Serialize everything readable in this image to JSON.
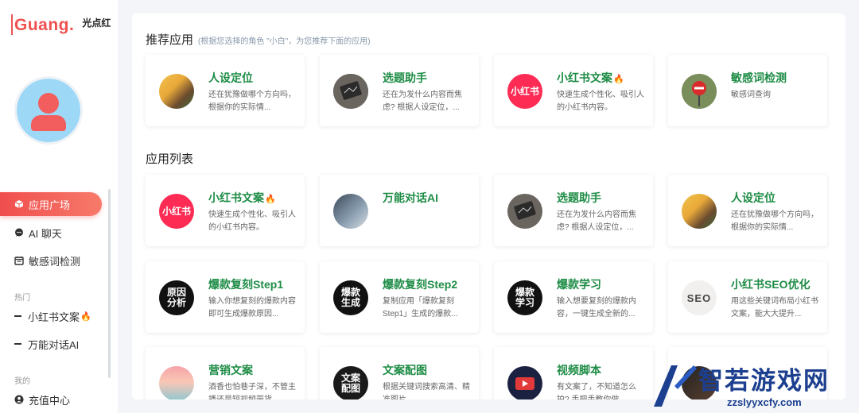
{
  "logo": {
    "main": "Guang.",
    "sub": "光点红"
  },
  "sidebar": {
    "nav": [
      {
        "label": "应用广场",
        "icon": "cube-icon",
        "active": true
      },
      {
        "label": "AI 聊天",
        "icon": "chat-icon",
        "active": false
      },
      {
        "label": "敏感词检测",
        "icon": "calendar-icon",
        "active": false
      }
    ],
    "hot_section": "热门",
    "hot": [
      {
        "label": "小红书文案",
        "fire": true
      },
      {
        "label": "万能对话AI",
        "fire": false
      }
    ],
    "mine_section": "我的",
    "mine": [
      {
        "label": "充值中心",
        "icon": "user-icon"
      }
    ]
  },
  "recommend": {
    "title": "推荐应用",
    "hint": "(根据您选择的角色 \"小白\"，为您推荐下面的应用)",
    "cards": [
      {
        "title": "人设定位",
        "desc": "还在犹豫做哪个方向吗，根据你的实际情...",
        "thumb": "person-photo-icon"
      },
      {
        "title": "选题助手",
        "desc": "还在为发什么内容而焦虑? 根据人设定位，...",
        "thumb": "tablet-icon"
      },
      {
        "title": "小红书文案",
        "desc": "快速生成个性化、吸引人的小红书内容。",
        "thumb": "xiaohongshu-logo-icon",
        "fire": true,
        "thumb_text": "小红书"
      },
      {
        "title": "敏感词检测",
        "desc": "敏感词查询",
        "thumb": "no-entry-sign-icon"
      }
    ]
  },
  "apps": {
    "title": "应用列表",
    "cards": [
      {
        "title": "小红书文案",
        "desc": "快速生成个性化、吸引人的小红书内容。",
        "thumb": "xiaohongshu-logo-icon",
        "fire": true,
        "thumb_text": "小红书"
      },
      {
        "title": "万能对话AI",
        "desc": "",
        "thumb": "handshake-photo-icon"
      },
      {
        "title": "选题助手",
        "desc": "还在为发什么内容而焦虑? 根据人设定位，...",
        "thumb": "tablet-icon"
      },
      {
        "title": "人设定位",
        "desc": "还在犹豫做哪个方向吗，根据你的实际情...",
        "thumb": "person-photo-icon"
      },
      {
        "title": "爆款复刻Step1",
        "desc": "输入你想复刻的爆款内容即可生成爆款原因...",
        "thumb": "text-badge-icon",
        "thumb_text": "原因分析"
      },
      {
        "title": "爆款复刻Step2",
        "desc": "复制应用「爆款复刻Step1」生成的爆款...",
        "thumb": "text-badge-icon",
        "thumb_text": "爆款生成"
      },
      {
        "title": "爆款学习",
        "desc": "输入想要复刻的爆款内容，一键生成全新的...",
        "thumb": "text-badge-icon",
        "thumb_text": "爆款学习"
      },
      {
        "title": "小红书SEO优化",
        "desc": "用这些关键词布局小红书文案，能大大提升...",
        "thumb": "seo-icon",
        "thumb_text": "SEO"
      },
      {
        "title": "营销文案",
        "desc": "酒香也怕巷子深，不管主播还是短视频带货...",
        "thumb": "sunset-photo-icon"
      },
      {
        "title": "文案配图",
        "desc": "根据关键词搜索高清、精准图片",
        "thumb": "text-badge-icon",
        "thumb_text": "文案配图"
      },
      {
        "title": "视频脚本",
        "desc": "有文案了，不知道怎么拍? 手把手教你做...",
        "thumb": "video-play-icon"
      },
      {
        "title": "",
        "desc": "",
        "thumb": "dark-photo-icon"
      }
    ]
  },
  "watermark": {
    "title": "智若游戏网",
    "url": "zzslyyxcfy.com"
  },
  "colors": {
    "accent": "#f04e4e",
    "title_green": "#1e8c46",
    "avatar_bg": "#9dd8f7"
  }
}
